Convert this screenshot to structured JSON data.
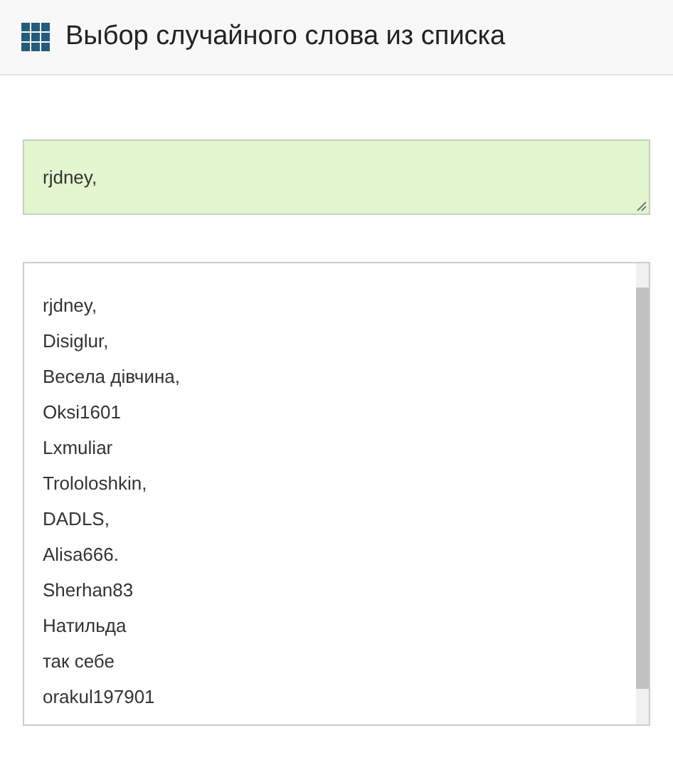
{
  "header": {
    "title": "Выбор случайного слова из списка"
  },
  "result": {
    "value": "rjdney,"
  },
  "list": {
    "items": [
      "rjdney,",
      "Disiglur,",
      "Весела дівчина,",
      "Oksi1601",
      "Lxmuliar",
      "Trololoshkin,",
      "DADLS,",
      "Alisa666.",
      "Sherhan83",
      "Натильда",
      "так себе",
      "orakul197901"
    ]
  }
}
